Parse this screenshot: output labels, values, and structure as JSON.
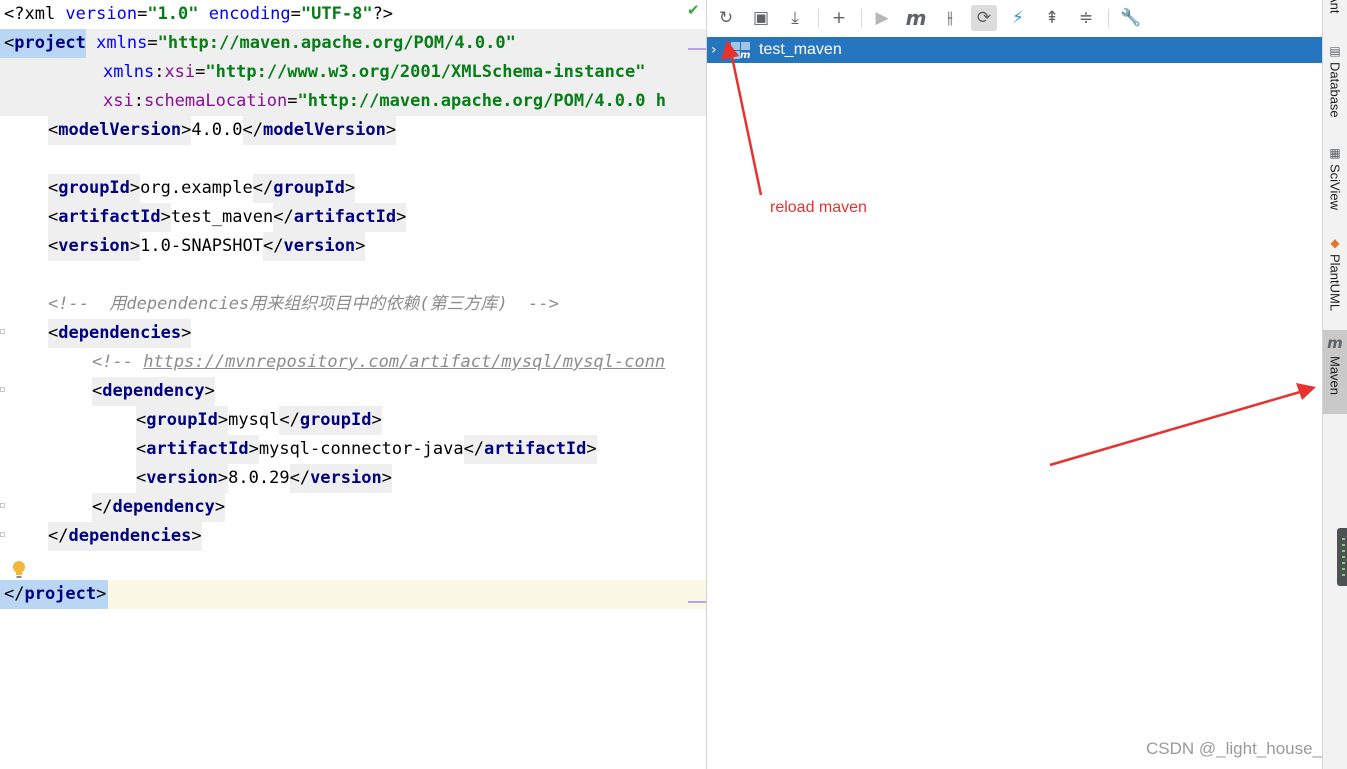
{
  "editor": {
    "lines": {
      "l1": {
        "pi_open": "<?xml ",
        "a1": "version",
        "v1": "\"1.0\"",
        "a2": "encoding",
        "v2": "\"UTF-8\"",
        "pi_close": "?>"
      },
      "l2": {
        "lt": "<",
        "tag": "project",
        "attr": "xmlns",
        "eq": "=",
        "val": "\"http://maven.apache.org/POM/4.0.0\""
      },
      "l3": {
        "ns": "xmlns",
        "colon": ":",
        "attr": "xsi",
        "eq": "=",
        "val": "\"http://www.w3.org/2001/XMLSchema-instance\""
      },
      "l4": {
        "ns": "xsi",
        "colon": ":",
        "attr": "schemaLocation",
        "eq": "=",
        "val": "\"http://maven.apache.org/POM/4.0.0 h"
      },
      "l5": {
        "open": "modelVersion",
        "text": "4.0.0",
        "close": "modelVersion"
      },
      "l7": {
        "open": "groupId",
        "text": "org.example",
        "close": "groupId"
      },
      "l8": {
        "open": "artifactId",
        "text": "test_maven",
        "close": "artifactId"
      },
      "l9": {
        "open": "version",
        "text": "1.0-SNAPSHOT",
        "close": "version"
      },
      "l11": {
        "text": "<!--  用dependencies用来组织项目中的依赖(第三方库)  -->"
      },
      "l12": {
        "tag": "dependencies"
      },
      "l13": {
        "prefix": "<!-- ",
        "link": "https://mvnrepository.com/artifact/mysql/mysql-conn"
      },
      "l14": {
        "tag": "dependency"
      },
      "l15": {
        "open": "groupId",
        "text": "mysql",
        "close": "groupId"
      },
      "l16": {
        "open": "artifactId",
        "text": "mysql-connector-java",
        "close": "artifactId"
      },
      "l17": {
        "open": "version",
        "text": "8.0.29",
        "close": "version"
      },
      "l18": {
        "tag": "dependency"
      },
      "l19": {
        "tag": "dependencies"
      },
      "l21": {
        "tag": "project"
      }
    }
  },
  "maven_panel": {
    "toolbar": {
      "reload": "↻",
      "generate_sources": "▣",
      "download": "⤓",
      "add": "+",
      "run": "▶",
      "execute_goal": "m",
      "toggle_offline": "⫲",
      "toggle_skip_tests": "⟳",
      "show_dependencies": "⚡",
      "expand_all": "⇞",
      "collapse_all": "≑",
      "settings": "🔧"
    },
    "tree": {
      "chevron": "›",
      "project_name": "test_maven"
    }
  },
  "tool_strip": {
    "items": [
      {
        "label": "Ant",
        "icon": "ant-icon"
      },
      {
        "label": "Database",
        "icon": "database-icon"
      },
      {
        "label": "SciView",
        "icon": "sciview-icon"
      },
      {
        "label": "PlantUML",
        "icon": "plantuml-icon"
      },
      {
        "label": "Maven",
        "icon": "maven-icon",
        "active": true
      }
    ]
  },
  "annotations": {
    "note": "reload maven",
    "color": "#e8322f"
  },
  "watermark": "CSDN @_light_house_",
  "colors": {
    "tag": "#00007f",
    "string": "#067d17",
    "comment": "#8c8c8c",
    "namespace": "#871094",
    "selection": "#2675bf"
  }
}
